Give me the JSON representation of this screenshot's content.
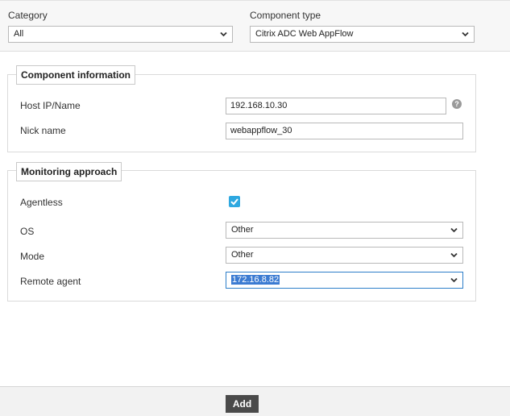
{
  "filters": {
    "category_label": "Category",
    "category_value": "All",
    "component_type_label": "Component type",
    "component_type_value": "Citrix ADC Web AppFlow"
  },
  "component_info": {
    "legend": "Component information",
    "host_label": "Host IP/Name",
    "host_value": "192.168.10.30",
    "nick_label": "Nick name",
    "nick_value": "webappflow_30",
    "help_glyph": "?"
  },
  "monitoring": {
    "legend": "Monitoring approach",
    "agentless_label": "Agentless",
    "agentless_checked": true,
    "os_label": "OS",
    "os_value": "Other",
    "mode_label": "Mode",
    "mode_value": "Other",
    "remote_agent_label": "Remote agent",
    "remote_agent_value": "172.16.8.82"
  },
  "footer": {
    "add_label": "Add"
  },
  "icons": {
    "dropdown": "chevron-down-icon",
    "help": "help-icon",
    "check": "checkmark-icon"
  },
  "colors": {
    "checkbox": "#2ea8e0",
    "button": "#4a4a4a",
    "focus_border": "#2e7fc9",
    "selection": "#3b7bd2"
  }
}
